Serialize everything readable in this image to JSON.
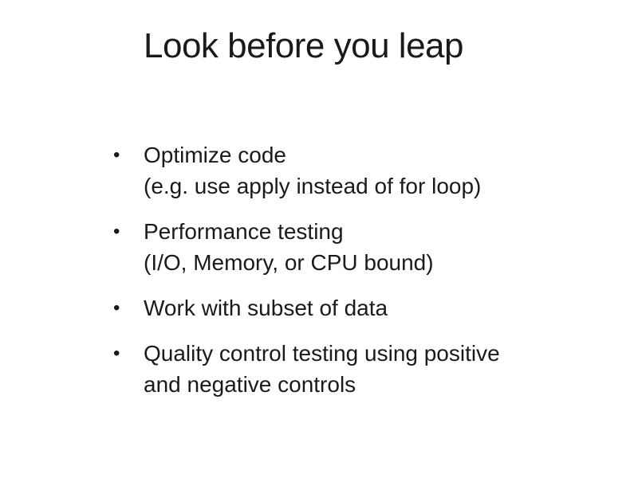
{
  "slide": {
    "title": "Look before you leap",
    "bullet_marker": "•",
    "bullets": [
      {
        "line1": "Optimize code",
        "line2": "(e.g. use apply instead of for loop)"
      },
      {
        "line1": "Performance testing",
        "line2": "(I/O, Memory, or CPU bound)"
      },
      {
        "line1": "Work with subset of data"
      },
      {
        "line1": "Quality control testing using positive",
        "line2": "and negative controls"
      }
    ]
  }
}
